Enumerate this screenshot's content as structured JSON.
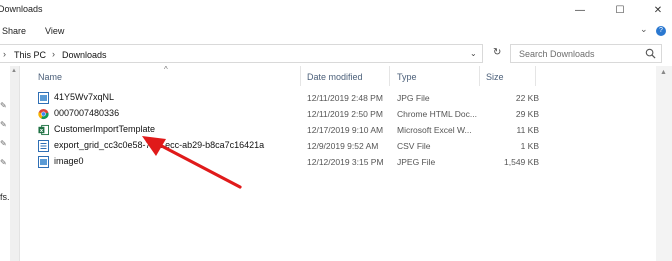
{
  "window": {
    "title": "Downloads",
    "minimize": "—",
    "maximize": "☐",
    "close": "✕"
  },
  "ribbon": {
    "tabs": [
      "Share",
      "View"
    ],
    "expand": "⌄",
    "help": "?"
  },
  "address": {
    "sep1": "›",
    "crumbs": [
      "This PC",
      "Downloads"
    ],
    "sep2": "›",
    "dropdown": "⌄",
    "refresh": "↻",
    "search_placeholder": "Search Downloads"
  },
  "nav": {
    "visible_text": "fs."
  },
  "columns": [
    "Name",
    "Date modified",
    "Type",
    "Size"
  ],
  "sort_indicator": "^",
  "files": [
    {
      "name": "41Y5Wv7xqNL",
      "date": "12/11/2019 2:48 PM",
      "type": "JPG File",
      "size": "22 KB",
      "icon": "image-file-icon"
    },
    {
      "name": "0007007480336",
      "date": "12/11/2019 2:50 PM",
      "type": "Chrome HTML Doc...",
      "size": "29 KB",
      "icon": "chrome-icon"
    },
    {
      "name": "CustomerImportTemplate",
      "date": "12/17/2019 9:10 AM",
      "type": "Microsoft Excel W...",
      "size": "11 KB",
      "icon": "excel-icon"
    },
    {
      "name": "export_grid_cc3c0e58-7fc...ecc-ab29-b8ca7c16421a",
      "date": "12/9/2019 9:52 AM",
      "type": "CSV File",
      "size": "1 KB",
      "icon": "csv-file-icon"
    },
    {
      "name": "image0",
      "date": "12/12/2019 3:15 PM",
      "type": "JPEG File",
      "size": "1,549 KB",
      "icon": "image-file-icon"
    }
  ],
  "colors": {
    "arrow": "#e01a1a",
    "header_text": "#4c607a",
    "excel": "#1f7244",
    "folder_icon": "#2f6fb5"
  }
}
